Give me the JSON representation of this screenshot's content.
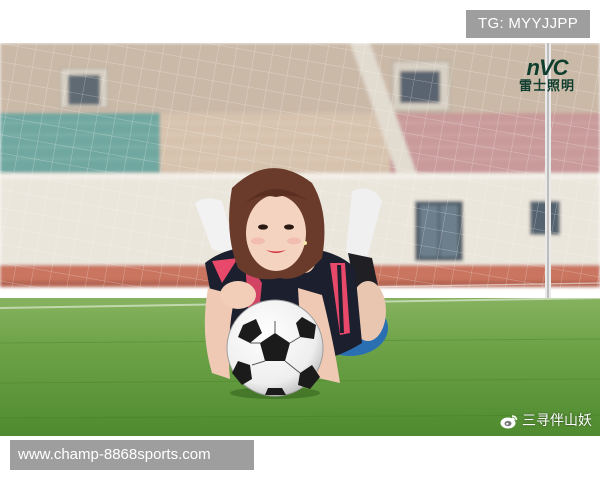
{
  "watermark_tag": "TG: MYYJJPP",
  "url_text": "www.champ-8868sports.com",
  "sponsor_logo": {
    "mark": "nVC",
    "text": "雷士照明"
  },
  "weibo_watermark": {
    "icon": "weibo-icon",
    "text": "三寻伴山妖"
  },
  "colors": {
    "badge_bg": "#9e9e9e",
    "grass": "#5f9a3c",
    "jersey": "#1c1f2e",
    "jersey_stripes": "#e8486a",
    "logo_green": "#0f3e2e"
  }
}
